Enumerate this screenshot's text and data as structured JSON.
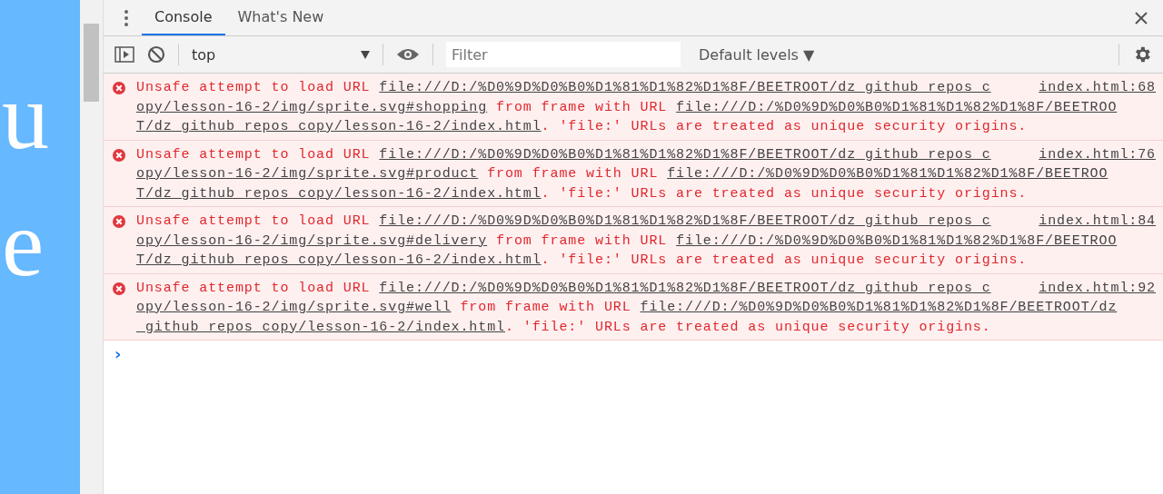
{
  "page": {
    "words": [
      "u",
      "e"
    ]
  },
  "tabs": [
    {
      "label": "Console",
      "selected": true
    },
    {
      "label": "What's New",
      "selected": false
    }
  ],
  "toolbar": {
    "context": "top",
    "filter": {
      "placeholder": "Filter"
    },
    "levels": "Default levels ▼"
  },
  "messages": [
    {
      "source": "index.html:68",
      "lines": [
        [
          {
            "kind": "text",
            "text": "Unsafe attempt to load URL "
          },
          {
            "kind": "link",
            "text": "file:///D:/%D0%9D%D0%B0%D1%81%D1%82%D1%8F/BEETROOT/dz_github_repos_c"
          }
        ],
        [
          {
            "kind": "link",
            "text": "opy/lesson-16-2/img/sprite.svg#shopping"
          },
          {
            "kind": "text",
            "text": " from frame with URL "
          },
          {
            "kind": "link",
            "text": "file:///D:/%D0%9D%D0%B0%D1%81%D1%82%D1%8F/BEETROO"
          }
        ],
        [
          {
            "kind": "link",
            "text": "T/dz_github_repos_copy/lesson-16-2/index.html"
          },
          {
            "kind": "text",
            "text": ". 'file:' URLs are treated as unique security origins."
          }
        ]
      ]
    },
    {
      "source": "index.html:76",
      "lines": [
        [
          {
            "kind": "text",
            "text": "Unsafe attempt to load URL "
          },
          {
            "kind": "link",
            "text": "file:///D:/%D0%9D%D0%B0%D1%81%D1%82%D1%8F/BEETROOT/dz_github_repos_c"
          }
        ],
        [
          {
            "kind": "link",
            "text": "opy/lesson-16-2/img/sprite.svg#product"
          },
          {
            "kind": "text",
            "text": " from frame with URL "
          },
          {
            "kind": "link",
            "text": "file:///D:/%D0%9D%D0%B0%D1%81%D1%82%D1%8F/BEETROO"
          }
        ],
        [
          {
            "kind": "link",
            "text": "T/dz_github_repos_copy/lesson-16-2/index.html"
          },
          {
            "kind": "text",
            "text": ". 'file:' URLs are treated as unique security origins."
          }
        ]
      ]
    },
    {
      "source": "index.html:84",
      "lines": [
        [
          {
            "kind": "text",
            "text": "Unsafe attempt to load URL "
          },
          {
            "kind": "link",
            "text": "file:///D:/%D0%9D%D0%B0%D1%81%D1%82%D1%8F/BEETROOT/dz_github_repos_c"
          }
        ],
        [
          {
            "kind": "link",
            "text": "opy/lesson-16-2/img/sprite.svg#delivery"
          },
          {
            "kind": "text",
            "text": " from frame with URL "
          },
          {
            "kind": "link",
            "text": "file:///D:/%D0%9D%D0%B0%D1%81%D1%82%D1%8F/BEETROO"
          }
        ],
        [
          {
            "kind": "link",
            "text": "T/dz_github_repos_copy/lesson-16-2/index.html"
          },
          {
            "kind": "text",
            "text": ". 'file:' URLs are treated as unique security origins."
          }
        ]
      ]
    },
    {
      "source": "index.html:92",
      "lines": [
        [
          {
            "kind": "text",
            "text": "Unsafe attempt to load URL "
          },
          {
            "kind": "link",
            "text": "file:///D:/%D0%9D%D0%B0%D1%81%D1%82%D1%8F/BEETROOT/dz_github_repos_c"
          }
        ],
        [
          {
            "kind": "link",
            "text": "opy/lesson-16-2/img/sprite.svg#well"
          },
          {
            "kind": "text",
            "text": " from frame with URL "
          },
          {
            "kind": "link",
            "text": "file:///D:/%D0%9D%D0%B0%D1%81%D1%82%D1%8F/BEETROOT/dz"
          }
        ],
        [
          {
            "kind": "link",
            "text": "_github_repos_copy/lesson-16-2/index.html"
          },
          {
            "kind": "text",
            "text": ". 'file:' URLs are treated as unique security origins."
          }
        ]
      ]
    }
  ],
  "prompt": "›"
}
